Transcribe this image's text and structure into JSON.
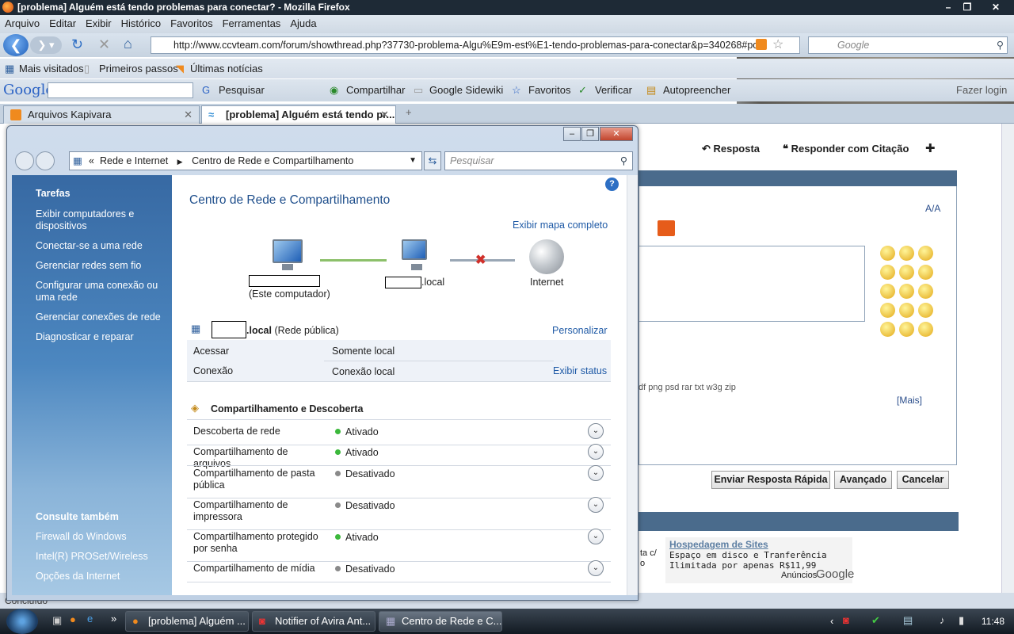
{
  "browser": {
    "title": "[problema] Alguém está tendo problemas para conectar? - Mozilla Firefox",
    "menu": [
      "Arquivo",
      "Editar",
      "Exibir",
      "Histórico",
      "Favoritos",
      "Ferramentas",
      "Ajuda"
    ],
    "url": "http://www.ccvteam.com/forum/showthread.php?37730-problema-Algu%E9m-est%E1-tendo-problemas-para-conectar&p=340268#post",
    "search_placeholder": "Google",
    "bookmarks": [
      "Mais visitados",
      "Primeiros passos",
      "Últimas notícias"
    ],
    "gtoolbar": {
      "logo": "Google",
      "pesquisar": "Pesquisar",
      "compartilhar": "Compartilhar",
      "sidewiki": "Google Sidewiki",
      "favoritos": "Favoritos",
      "verificar": "Verificar",
      "autopreencher": "Autopreencher",
      "login": "Fazer login"
    },
    "tabs": [
      "Arquivos Kapivara",
      "[problema] Alguém está tendo pr..."
    ],
    "status": "Concluído"
  },
  "forum": {
    "resposta": "Resposta",
    "citacao": "Responder com Citação",
    "attach_types": "df png psd rar txt w3g zip",
    "mais": "[Mais]",
    "buttons": [
      "Enviar Resposta Rápida",
      "Avançado",
      "Cancelar"
    ],
    "ad_title": "Hospedagem de Sites",
    "ad_line1": "Espaço em disco e Tranferência",
    "ad_line2": "Ilimitada por apenas R$11,99",
    "ad_left1": "ta c/",
    "ad_left2": "o",
    "ads_by": "Anúncios",
    "ads_brand": "Google"
  },
  "explorer": {
    "breadcrumb": [
      "Rede e Internet",
      "Centro de Rede e Compartilhamento"
    ],
    "breadcrumb_prefix": "«",
    "search_placeholder": "Pesquisar",
    "tasks_heading": "Tarefas",
    "tasks": [
      "Exibir computadores e dispositivos",
      "Conectar-se a uma rede",
      "Gerenciar redes sem fio",
      "Configurar uma conexão ou uma rede",
      "Gerenciar conexões de rede",
      "Diagnosticar e reparar"
    ],
    "see_also_heading": "Consulte também",
    "see_also": [
      "Firewall do Windows",
      "Intel(R) PROSet/Wireless",
      "Opções da Internet"
    ],
    "title": "Centro de Rede e Compartilhamento",
    "full_map": "Exibir mapa completo",
    "map_this": "(Este computador)",
    "map_local": ".local",
    "map_internet": "Internet",
    "network_name": ".local",
    "network_type": "(Rede pública)",
    "personalizar": "Personalizar",
    "access_label": "Acessar",
    "access_value": "Somente local",
    "conn_label": "Conexão",
    "conn_value": "Conexão local",
    "view_status": "Exibir status",
    "sharing_heading": "Compartilhamento e Descoberta",
    "sharing": [
      {
        "label": "Descoberta de rede",
        "value": "Ativado",
        "on": true
      },
      {
        "label": "Compartilhamento de arquivos",
        "value": "Ativado",
        "on": true
      },
      {
        "label": "Compartilhamento de pasta pública",
        "value": "Desativado",
        "on": false
      },
      {
        "label": "Compartilhamento de impressora",
        "value": "Desativado",
        "on": false
      },
      {
        "label": "Compartilhamento protegido por senha",
        "value": "Ativado",
        "on": true
      },
      {
        "label": "Compartilhamento de mídia",
        "value": "Desativado",
        "on": false
      }
    ]
  },
  "taskbar": {
    "buttons": [
      "[problema] Alguém ...",
      "Notifier of Avira Ant...",
      "Centro de Rede e C..."
    ],
    "clock": "11:48"
  },
  "colors": {
    "on": "#3cb83c",
    "off": "#8a8a8a",
    "link": "#1f5aa6",
    "nav": "#3769a3"
  }
}
